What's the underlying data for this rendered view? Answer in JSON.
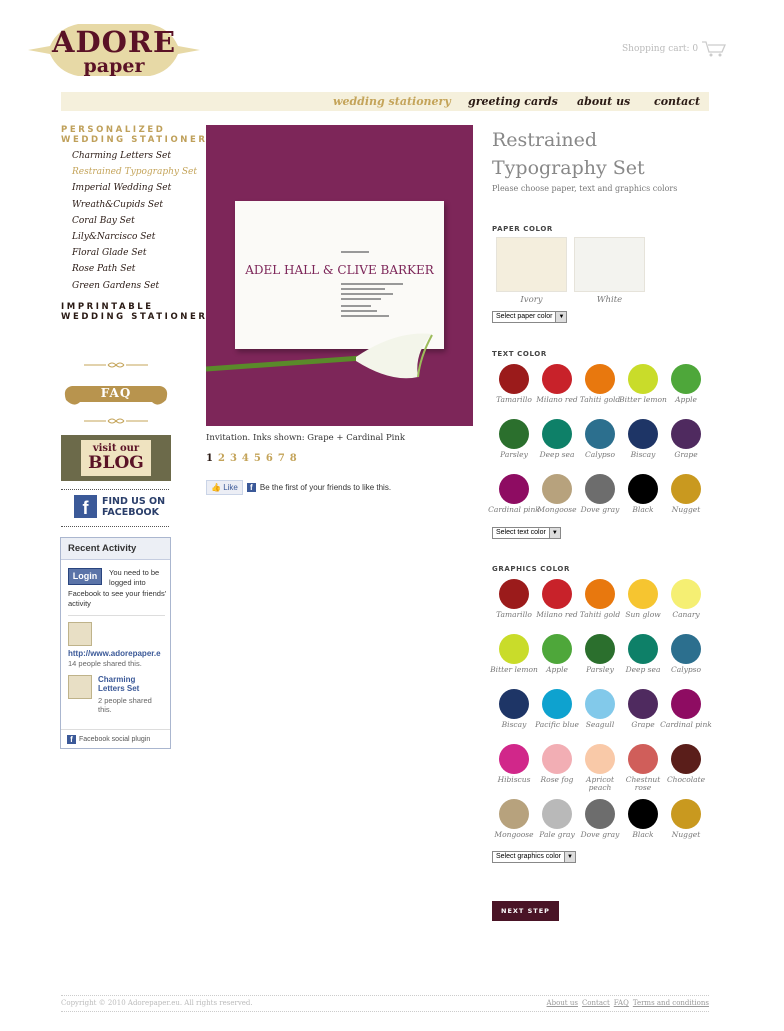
{
  "brand": {
    "line1": "ADORE",
    "line2": "paper"
  },
  "cart": {
    "label": "Shopping cart: 0"
  },
  "nav": [
    {
      "label": "wedding stationery",
      "active": true
    },
    {
      "label": "greeting cards",
      "active": false
    },
    {
      "label": "about us",
      "active": false
    },
    {
      "label": "contact",
      "active": false
    }
  ],
  "sidebar": {
    "heading1": "PERSONALIZED\nWEDDING STATIONERY",
    "heading1_a": "PERSONALIZED",
    "heading1_b": "WEDDING STATIONERY",
    "items": [
      {
        "label": "Charming Letters Set",
        "active": false
      },
      {
        "label": "Restrained Typography Set",
        "active": true
      },
      {
        "label": "Imperial Wedding Set",
        "active": false
      },
      {
        "label": "Wreath&Cupids Set",
        "active": false
      },
      {
        "label": "Coral Bay Set",
        "active": false
      },
      {
        "label": "Lily&Narcisco Set",
        "active": false
      },
      {
        "label": "Floral Glade Set",
        "active": false
      },
      {
        "label": "Rose Path Set",
        "active": false
      },
      {
        "label": "Green Gardens Set",
        "active": false
      }
    ],
    "heading2_a": "IMPRINTABLE",
    "heading2_b": "WEDDING STATIONERY",
    "faq": "FAQ",
    "blog_line1": "visit our",
    "blog_line2": "BLOG",
    "fb_line1": "FIND US ON",
    "fb_line2": "FACEBOOK"
  },
  "recent_activity": {
    "title": "Recent Activity",
    "login": "Login",
    "note_a": "You need to be logged into",
    "note_b": "Facebook to see your friends' activity",
    "item1_link": "http://www.adorepaper.e",
    "item1_meta": "14 people shared this.",
    "item2_link_a": "Charming",
    "item2_link_b": "Letters Set",
    "item2_meta": "2 people shared this.",
    "footer": "Facebook social plugin"
  },
  "product": {
    "card_names": "ADEL HALL & CLIVE BARKER",
    "caption": "Invitation. Inks shown: Grape + Cardinal Pink",
    "pages": [
      "1",
      "2",
      "3",
      "4",
      "5",
      "6",
      "7",
      "8"
    ],
    "current_page": "1",
    "like": "Like",
    "like_note": "Be the first of your friends to like this."
  },
  "options": {
    "title": "Restrained Typography Set",
    "subtitle": "Please choose paper, text and graphics colors",
    "paper_label": "PAPER COLOR",
    "paper": [
      {
        "name": "Ivory",
        "color": "#f4eedd"
      },
      {
        "name": "White",
        "color": "#f3f3ef"
      }
    ],
    "paper_select": "Select paper color",
    "text_label": "TEXT COLOR",
    "text_colors": [
      {
        "name": "Tamarillo",
        "color": "#9b1b1b"
      },
      {
        "name": "Milano red",
        "color": "#c8222a"
      },
      {
        "name": "Tahiti gold",
        "color": "#e8780e"
      },
      {
        "name": "Bitter lemon",
        "color": "#c9dc2a"
      },
      {
        "name": "Apple",
        "color": "#4ea73a"
      },
      {
        "name": "Parsley",
        "color": "#2b6f2d"
      },
      {
        "name": "Deep sea",
        "color": "#0e8068"
      },
      {
        "name": "Calypso",
        "color": "#2c6f8e"
      },
      {
        "name": "Biscay",
        "color": "#1e3566"
      },
      {
        "name": "Grape",
        "color": "#4f2a5f"
      },
      {
        "name": "Cardinal pink",
        "color": "#8e0c62"
      },
      {
        "name": "Mongoose",
        "color": "#b7a27d"
      },
      {
        "name": "Dove gray",
        "color": "#6d6d6d"
      },
      {
        "name": "Black",
        "color": "#000000"
      },
      {
        "name": "Nugget",
        "color": "#c9991f"
      }
    ],
    "text_select": "Select text color",
    "graphics_label": "GRAPHICS COLOR",
    "graphics_colors": [
      {
        "name": "Tamarillo",
        "color": "#9b1b1b"
      },
      {
        "name": "Milano red",
        "color": "#c8222a"
      },
      {
        "name": "Tahiti gold",
        "color": "#e8780e"
      },
      {
        "name": "Sun glow",
        "color": "#f6c530"
      },
      {
        "name": "Canary",
        "color": "#f5ef73"
      },
      {
        "name": "Bitter lemon",
        "color": "#c9dc2a"
      },
      {
        "name": "Apple",
        "color": "#4ea73a"
      },
      {
        "name": "Parsley",
        "color": "#2b6f2d"
      },
      {
        "name": "Deep sea",
        "color": "#0e8068"
      },
      {
        "name": "Calypso",
        "color": "#2c6f8e"
      },
      {
        "name": "Biscay",
        "color": "#1e3566"
      },
      {
        "name": "Pacific blue",
        "color": "#0ea2cf"
      },
      {
        "name": "Seagull",
        "color": "#82c9ea"
      },
      {
        "name": "Grape",
        "color": "#4f2a5f"
      },
      {
        "name": "Cardinal pink",
        "color": "#8e0c62"
      },
      {
        "name": "Hibiscus",
        "color": "#d1278a"
      },
      {
        "name": "Rose fog",
        "color": "#f2aeb4"
      },
      {
        "name": "Apricot peach",
        "color": "#f9c9a8"
      },
      {
        "name": "Chestnut rose",
        "color": "#d05e5a"
      },
      {
        "name": "Chocolate",
        "color": "#5a1e1a"
      },
      {
        "name": "Mongoose",
        "color": "#b7a27d"
      },
      {
        "name": "Pale gray",
        "color": "#b9b9b9"
      },
      {
        "name": "Dove gray",
        "color": "#6d6d6d"
      },
      {
        "name": "Black",
        "color": "#000000"
      },
      {
        "name": "Nugget",
        "color": "#c9991f"
      }
    ],
    "graphics_select": "Select graphics color",
    "next": "NEXT STEP"
  },
  "footer": {
    "copyright": "Copyright © 2010 Adorepaper.eu. All rights reserved.",
    "links": [
      "About us",
      "Contact",
      "FAQ",
      "Terms and conditions"
    ]
  },
  "accent": {
    "gold": "#c4a45a",
    "burgundy": "#5a1226",
    "nav_bg": "#f5f0dc"
  }
}
